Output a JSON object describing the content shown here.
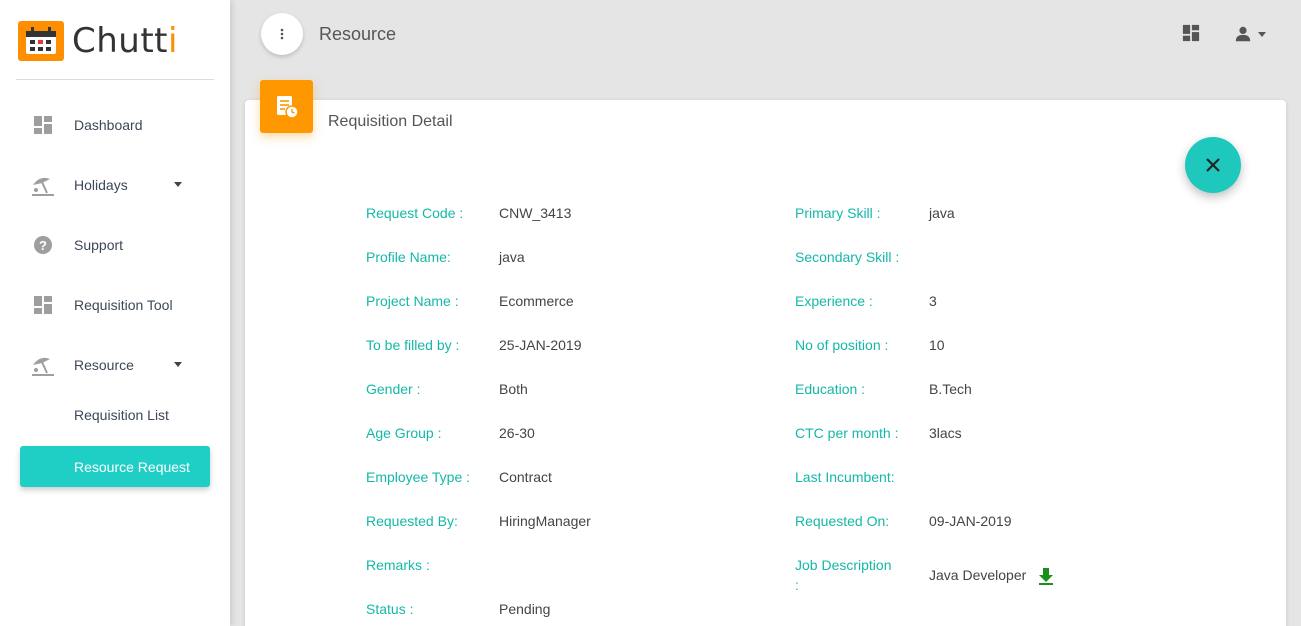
{
  "app": {
    "logo_text_main": "Chutt",
    "logo_text_accent": "i"
  },
  "sidebar": {
    "items": [
      {
        "label": "Dashboard",
        "icon": "dashboard-icon"
      },
      {
        "label": "Holidays",
        "icon": "beach-icon"
      },
      {
        "label": "Support",
        "icon": "help-icon"
      },
      {
        "label": "Requisition Tool",
        "icon": "dashboard-icon"
      },
      {
        "label": "Resource",
        "icon": "beach-icon"
      },
      {
        "label": "Requisition List"
      },
      {
        "label": "Resource Request"
      }
    ]
  },
  "header": {
    "title": "Resource"
  },
  "card": {
    "title": "Requisition Detail"
  },
  "details": {
    "left": [
      {
        "label": "Request Code :",
        "value": "CNW_3413"
      },
      {
        "label": "Profile Name:",
        "value": "java"
      },
      {
        "label": "Project Name :",
        "value": "Ecommerce"
      },
      {
        "label": "To be filled by :",
        "value": "25-JAN-2019"
      },
      {
        "label": "Gender :",
        "value": "Both"
      },
      {
        "label": "Age Group :",
        "value": "26-30"
      },
      {
        "label": "Employee Type :",
        "value": "Contract"
      },
      {
        "label": "Requested By:",
        "value": "HiringManager"
      },
      {
        "label": "Remarks :",
        "value": ""
      },
      {
        "label": "Status :",
        "value": "Pending"
      }
    ],
    "right": [
      {
        "label": "Primary Skill :",
        "value": "java"
      },
      {
        "label": "Secondary Skill :",
        "value": ""
      },
      {
        "label": "Experience :",
        "value": "3"
      },
      {
        "label": "No of position :",
        "value": "10"
      },
      {
        "label": "Education :",
        "value": "B.Tech"
      },
      {
        "label": "CTC per month :",
        "value": "3lacs"
      },
      {
        "label": "Last Incumbent:",
        "value": ""
      },
      {
        "label": "Requested On:",
        "value": "09-JAN-2019"
      },
      {
        "label": "Job Description",
        "label_line2": ":",
        "value": "Java Developer"
      }
    ]
  },
  "colors": {
    "accent_teal": "#1fcfc6",
    "label_teal": "#14b8a8",
    "orange": "#ff9800",
    "download_green": "#1a8f1a"
  }
}
